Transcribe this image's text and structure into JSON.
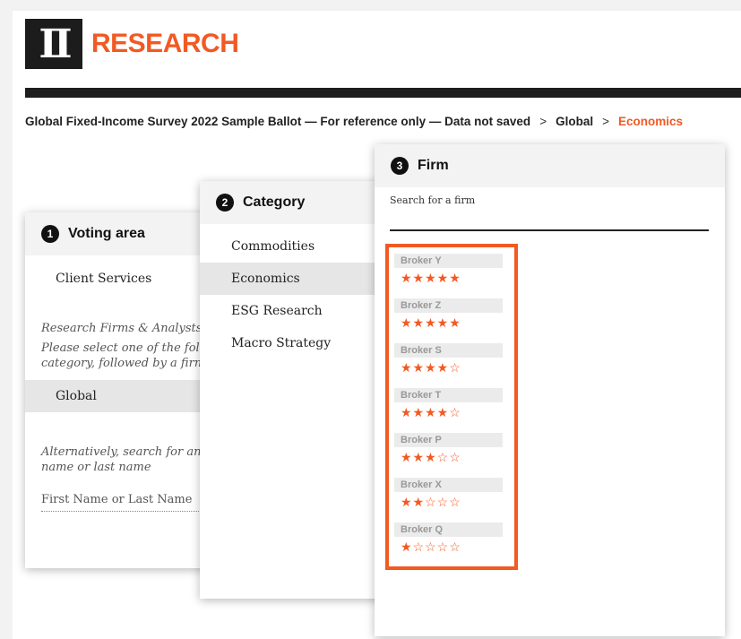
{
  "brand": {
    "logo_mark": "II",
    "logo_text": "RESEARCH",
    "accent": "#f15a22"
  },
  "breadcrumb": {
    "items": [
      "Global Fixed-Income Survey 2022 Sample Ballot — For reference only — Data not saved",
      "Global",
      "Economics"
    ],
    "separator": ">"
  },
  "panel1": {
    "step": "1",
    "title": "Voting area",
    "client_services": "Client Services",
    "note1": [
      "Research Firms & Analysts",
      "Please select one of the following",
      "category, followed by a firm"
    ],
    "global": "Global",
    "note2": [
      "Alternatively, search for an analyst by first",
      "name or last name"
    ],
    "name_placeholder": "First Name or Last Name"
  },
  "panel2": {
    "step": "2",
    "title": "Category",
    "items": [
      "Commodities",
      "Economics",
      "ESG Research",
      "Macro Strategy"
    ],
    "selected": "Economics"
  },
  "panel3": {
    "step": "3",
    "title": "Firm",
    "search_label": "Search for a firm",
    "search_value": "",
    "firms": [
      {
        "name": "Broker Y",
        "rating": 5,
        "stars": "★★★★★"
      },
      {
        "name": "Broker Z",
        "rating": 5,
        "stars": "★★★★★"
      },
      {
        "name": "Broker S",
        "rating": 4,
        "stars": "★★★★☆"
      },
      {
        "name": "Broker T",
        "rating": 4,
        "stars": "★★★★☆"
      },
      {
        "name": "Broker P",
        "rating": 3,
        "stars": "★★★☆☆"
      },
      {
        "name": "Broker X",
        "rating": 2,
        "stars": "★★☆☆☆"
      },
      {
        "name": "Broker Q",
        "rating": 1,
        "stars": "★☆☆☆☆"
      }
    ]
  }
}
